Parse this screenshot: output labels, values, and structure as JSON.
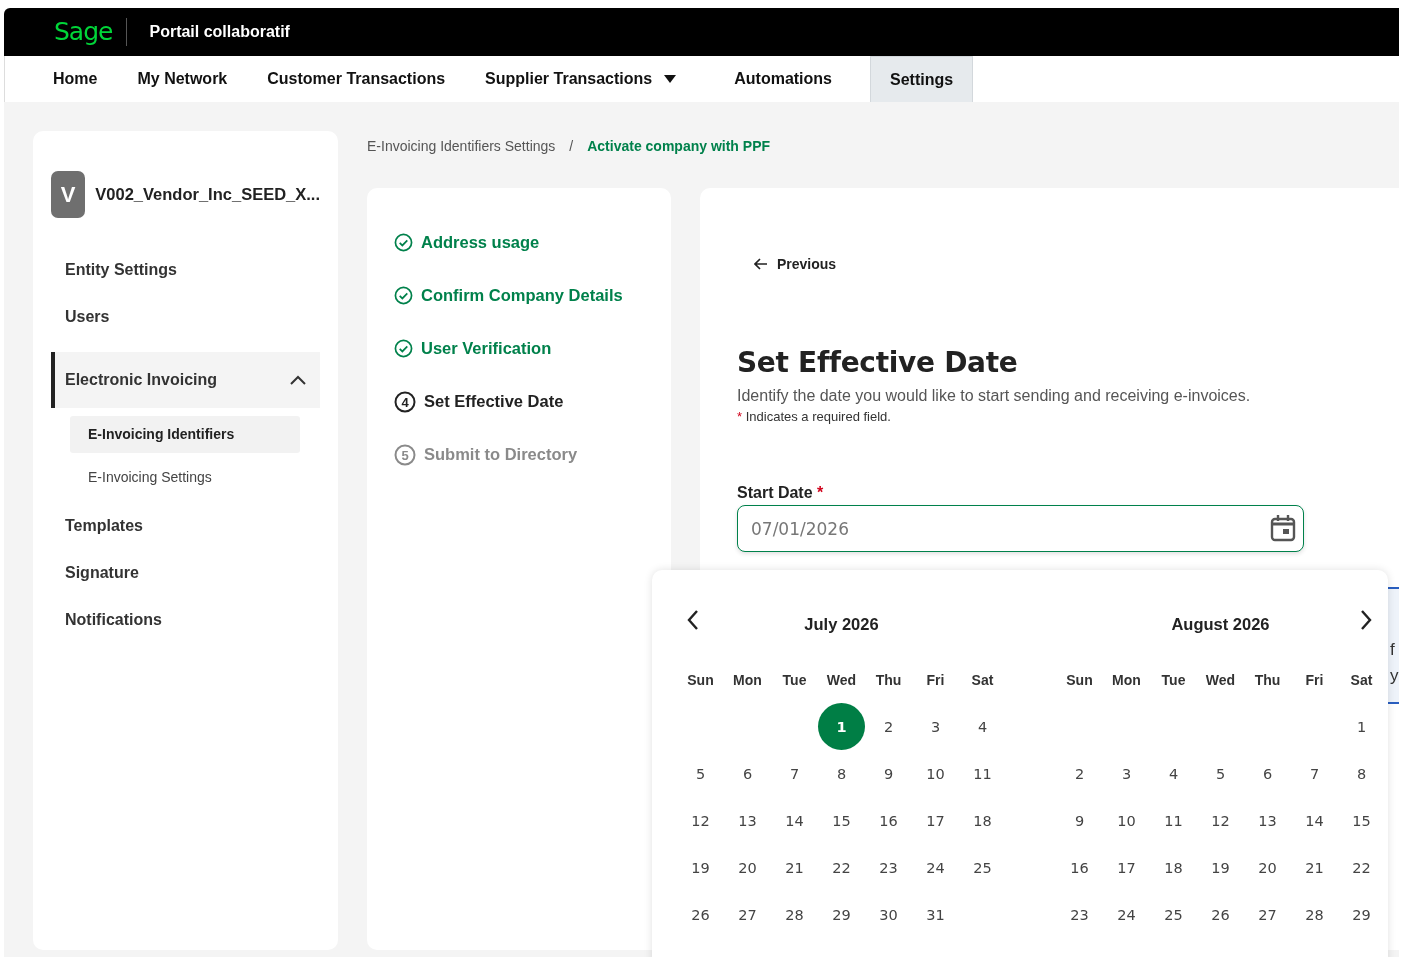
{
  "header": {
    "logo": "Sage",
    "title": "Portail collaboratif"
  },
  "nav": [
    {
      "label": "Home",
      "selected": false,
      "dropdown": false
    },
    {
      "label": "My Network",
      "selected": false,
      "dropdown": false
    },
    {
      "label": "Customer Transactions",
      "selected": false,
      "dropdown": false
    },
    {
      "label": "Supplier Transactions",
      "selected": false,
      "dropdown": true
    },
    {
      "label": "Automations",
      "selected": false,
      "dropdown": false
    },
    {
      "label": "Settings",
      "selected": true,
      "dropdown": false
    }
  ],
  "sidebar": {
    "avatar": "V",
    "entity": "V002_Vendor_Inc_SEED_X...",
    "items": [
      {
        "label": "Entity Settings",
        "selected": false
      },
      {
        "label": "Users",
        "selected": false
      },
      {
        "label": "Electronic Invoicing",
        "selected": true,
        "expanded": true,
        "children": [
          {
            "label": "E-Invoicing Identifiers",
            "selected": true
          },
          {
            "label": "E-Invoicing Settings",
            "selected": false
          }
        ]
      },
      {
        "label": "Templates",
        "selected": false
      },
      {
        "label": "Signature",
        "selected": false
      },
      {
        "label": "Notifications",
        "selected": false
      }
    ]
  },
  "breadcrumb": {
    "separator": "/",
    "items": [
      {
        "label": "E-Invoicing Identifiers Settings",
        "selected": false
      },
      {
        "label": "Activate company with PPF",
        "selected": true
      }
    ]
  },
  "steps": [
    {
      "label": "Address usage",
      "kind": "done"
    },
    {
      "label": "Confirm Company Details",
      "kind": "done"
    },
    {
      "label": "User Verification",
      "kind": "done"
    },
    {
      "label": "Set Effective Date",
      "kind": "current",
      "number": "4"
    },
    {
      "label": "Submit to Directory",
      "kind": "pending",
      "number": "5"
    }
  ],
  "form": {
    "back": "Previous",
    "title": "Set Effective Date",
    "description": "Identify the date you would like to start sending and receiving e-invoices.",
    "required_mark": "*",
    "required_note": "Indicates a required field.",
    "field_label": "Start Date",
    "field_required_mark": "*",
    "field_value": "07/01/2026"
  },
  "calendar": {
    "months": [
      {
        "title": "July 2026",
        "has_prev": true,
        "weekdays": [
          "Sun",
          "Mon",
          "Tue",
          "Wed",
          "Thu",
          "Fri",
          "Sat"
        ],
        "days": [
          {
            "kind": "blank"
          },
          {
            "kind": "blank"
          },
          {
            "kind": "blank"
          },
          {
            "kind": "day",
            "label": "1",
            "selected": true
          },
          {
            "kind": "day",
            "label": "2",
            "selected": false
          },
          {
            "kind": "day",
            "label": "3",
            "selected": false
          },
          {
            "kind": "day",
            "label": "4",
            "selected": false
          },
          {
            "kind": "day",
            "label": "5",
            "selected": false
          },
          {
            "kind": "day",
            "label": "6",
            "selected": false
          },
          {
            "kind": "day",
            "label": "7",
            "selected": false
          },
          {
            "kind": "day",
            "label": "8",
            "selected": false
          },
          {
            "kind": "day",
            "label": "9",
            "selected": false
          },
          {
            "kind": "day",
            "label": "10",
            "selected": false
          },
          {
            "kind": "day",
            "label": "11",
            "selected": false
          },
          {
            "kind": "day",
            "label": "12",
            "selected": false
          },
          {
            "kind": "day",
            "label": "13",
            "selected": false
          },
          {
            "kind": "day",
            "label": "14",
            "selected": false
          },
          {
            "kind": "day",
            "label": "15",
            "selected": false
          },
          {
            "kind": "day",
            "label": "16",
            "selected": false
          },
          {
            "kind": "day",
            "label": "17",
            "selected": false
          },
          {
            "kind": "day",
            "label": "18",
            "selected": false
          },
          {
            "kind": "day",
            "label": "19",
            "selected": false
          },
          {
            "kind": "day",
            "label": "20",
            "selected": false
          },
          {
            "kind": "day",
            "label": "21",
            "selected": false
          },
          {
            "kind": "day",
            "label": "22",
            "selected": false
          },
          {
            "kind": "day",
            "label": "23",
            "selected": false
          },
          {
            "kind": "day",
            "label": "24",
            "selected": false
          },
          {
            "kind": "day",
            "label": "25",
            "selected": false
          },
          {
            "kind": "day",
            "label": "26",
            "selected": false
          },
          {
            "kind": "day",
            "label": "27",
            "selected": false
          },
          {
            "kind": "day",
            "label": "28",
            "selected": false
          },
          {
            "kind": "day",
            "label": "29",
            "selected": false
          },
          {
            "kind": "day",
            "label": "30",
            "selected": false
          },
          {
            "kind": "day",
            "label": "31",
            "selected": false
          }
        ]
      },
      {
        "title": "August 2026",
        "has_next": true,
        "weekdays": [
          "Sun",
          "Mon",
          "Tue",
          "Wed",
          "Thu",
          "Fri",
          "Sat"
        ],
        "days": [
          {
            "kind": "blank"
          },
          {
            "kind": "blank"
          },
          {
            "kind": "blank"
          },
          {
            "kind": "blank"
          },
          {
            "kind": "blank"
          },
          {
            "kind": "blank"
          },
          {
            "kind": "day",
            "label": "1",
            "selected": false
          },
          {
            "kind": "day",
            "label": "2",
            "selected": false
          },
          {
            "kind": "day",
            "label": "3",
            "selected": false
          },
          {
            "kind": "day",
            "label": "4",
            "selected": false
          },
          {
            "kind": "day",
            "label": "5",
            "selected": false
          },
          {
            "kind": "day",
            "label": "6",
            "selected": false
          },
          {
            "kind": "day",
            "label": "7",
            "selected": false
          },
          {
            "kind": "day",
            "label": "8",
            "selected": false
          },
          {
            "kind": "day",
            "label": "9",
            "selected": false
          },
          {
            "kind": "day",
            "label": "10",
            "selected": false
          },
          {
            "kind": "day",
            "label": "11",
            "selected": false
          },
          {
            "kind": "day",
            "label": "12",
            "selected": false
          },
          {
            "kind": "day",
            "label": "13",
            "selected": false
          },
          {
            "kind": "day",
            "label": "14",
            "selected": false
          },
          {
            "kind": "day",
            "label": "15",
            "selected": false
          },
          {
            "kind": "day",
            "label": "16",
            "selected": false
          },
          {
            "kind": "day",
            "label": "17",
            "selected": false
          },
          {
            "kind": "day",
            "label": "18",
            "selected": false
          },
          {
            "kind": "day",
            "label": "19",
            "selected": false
          },
          {
            "kind": "day",
            "label": "20",
            "selected": false
          },
          {
            "kind": "day",
            "label": "21",
            "selected": false
          },
          {
            "kind": "day",
            "label": "22",
            "selected": false
          },
          {
            "kind": "day",
            "label": "23",
            "selected": false
          },
          {
            "kind": "day",
            "label": "24",
            "selected": false
          },
          {
            "kind": "day",
            "label": "25",
            "selected": false
          },
          {
            "kind": "day",
            "label": "26",
            "selected": false
          },
          {
            "kind": "day",
            "label": "27",
            "selected": false
          },
          {
            "kind": "day",
            "label": "28",
            "selected": false
          },
          {
            "kind": "day",
            "label": "29",
            "selected": false
          }
        ]
      }
    ]
  },
  "side_notice": {
    "lines": [
      "f",
      "y"
    ]
  }
}
